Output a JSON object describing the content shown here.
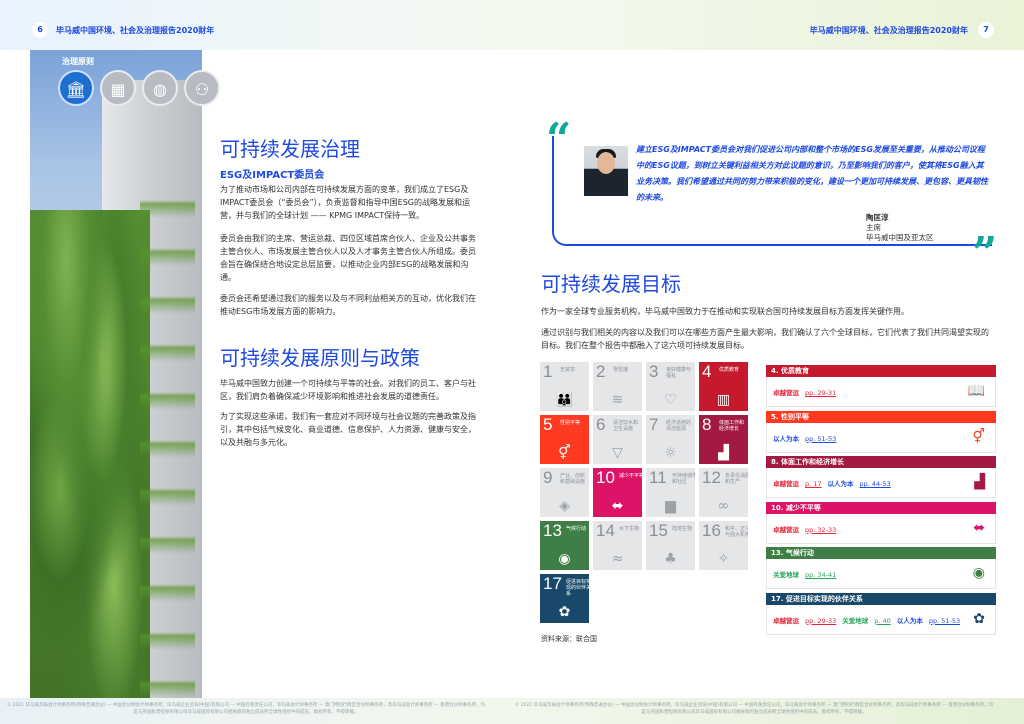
{
  "header": {
    "left_page": "6",
    "right_page": "7",
    "left_title": "毕马威中国环境、社会及治理报告2020财年",
    "right_title": "毕马威中国环境、社会及治理报告2020财年"
  },
  "governance": {
    "tag": "治理原则",
    "icons": [
      {
        "name": "pillars-icon",
        "glyph": "🏛"
      },
      {
        "name": "building-icon",
        "glyph": "▦"
      },
      {
        "name": "globe-icon",
        "glyph": "◍"
      },
      {
        "name": "people-icon",
        "glyph": "⚇"
      }
    ]
  },
  "left": {
    "title1": "可持续发展治理",
    "subtitle1": "ESG及IMPACT委员会",
    "p1": "为了推动市场和公司内部在可持续发展方面的变革，我们成立了ESG及IMPACT委员会（“委员会”），负责监督和指导中国ESG的战略发展和运营，并与我们的全球计划 —— KPMG IMPACT保持一致。",
    "p2": "委员会由我们的主席、营运总裁、四位区域首席合伙人、企业及公共事务主管合伙人、市场发展主管合伙人以及人才事务主管合伙人所组成。委员会旨在确保结合地设定总层监要，以推动企业内部ESG的战略发展和沟通。",
    "p3": "委员会还希望通过我们的服务以及与不同利益相关方的互动，优化我们在推动ESG市场发展方面的影响力。",
    "title2": "可持续发展原则与政策",
    "p4": "毕马威中国致力创建一个可持续与平等的社会。对我们的员工、客户与社区，我们肩负着确保减少环境影响和推进社会发展的道德责任。",
    "p5": "为了实现这些承诺，我们有一套应对不同环境与社会议题的完善政策及指引，其中包括气候变化、商业道德、信息保护、人力资源、健康与安全，以及共融与多元化。"
  },
  "quote": {
    "text": "建立ESG及IMPACT委员会对我们促进公司内部和整个市场的ESG发展至关重要，从推动公司议程中的ESG议题，到树立关键利益相关方对此议题的意识，乃至影响我们的客户，使其将ESG融入其业务决策。我们希望通过共同的努力带来积极的变化，建设一个更加可持续发展、更包容、更具韧性的未来。",
    "name": "陶匡淳",
    "role": "主席",
    "org": "毕马威中国及亚太区"
  },
  "right": {
    "title": "可持续发展目标",
    "p1": "作为一家全球专业服务机构，毕马威中国致力于在推动和实现联合国可持续发展目标方面发挥关键作用。",
    "p2": "通过识别与我们相关的内容以及我们可以在哪些方面产生最大影响，我们确认了六个全球目标，它们代表了我们共同渴望实现的目标。我们在整个报告中都融入了这六项可持续发展目标。",
    "source": "资料来源：联合国"
  },
  "sdg_tiles": [
    {
      "num": "1",
      "label": "无贫穷",
      "icon": "👪",
      "active": false,
      "color": "#e5243b"
    },
    {
      "num": "2",
      "label": "零饥饿",
      "icon": "≋",
      "active": false,
      "color": "#dda63a"
    },
    {
      "num": "3",
      "label": "良好健康与福祉",
      "icon": "♡",
      "active": false,
      "color": "#4c9f38"
    },
    {
      "num": "4",
      "label": "优质教育",
      "icon": "▥",
      "active": true,
      "color": "#c5192d"
    },
    {
      "num": "5",
      "label": "性别平等",
      "icon": "⚥",
      "active": true,
      "color": "#ff3a21"
    },
    {
      "num": "6",
      "label": "清洁饮水和卫生设施",
      "icon": "▽",
      "active": false,
      "color": "#26bde2"
    },
    {
      "num": "7",
      "label": "经济适用的清洁能源",
      "icon": "☼",
      "active": false,
      "color": "#fcc30b"
    },
    {
      "num": "8",
      "label": "体面工作和经济增长",
      "icon": "▟",
      "active": true,
      "color": "#a21942"
    },
    {
      "num": "9",
      "label": "产业、创新和基础设施",
      "icon": "◈",
      "active": false,
      "color": "#fd6925"
    },
    {
      "num": "10",
      "label": "减少不平等",
      "icon": "⬌",
      "active": true,
      "color": "#dd1367"
    },
    {
      "num": "11",
      "label": "可持续城市和社区",
      "icon": "▆",
      "active": false,
      "color": "#fd9d24"
    },
    {
      "num": "12",
      "label": "负责任消费和生产",
      "icon": "∞",
      "active": false,
      "color": "#bf8b2e"
    },
    {
      "num": "13",
      "label": "气候行动",
      "icon": "◉",
      "active": true,
      "color": "#3f7e44"
    },
    {
      "num": "14",
      "label": "水下生物",
      "icon": "≈",
      "active": false,
      "color": "#0a97d9"
    },
    {
      "num": "15",
      "label": "陆地生物",
      "icon": "♣",
      "active": false,
      "color": "#56c02b"
    },
    {
      "num": "16",
      "label": "和平、正义与强大机构",
      "icon": "✧",
      "active": false,
      "color": "#00689d"
    },
    {
      "num": "17",
      "label": "促进目标实现的伙伴关系",
      "icon": "✿",
      "active": true,
      "color": "#19486a"
    }
  ],
  "goals": [
    {
      "title": "4. 优质教育",
      "color": "#c5192d",
      "icon": "📖",
      "links": [
        {
          "cat": "卓越营运",
          "page": "pp. 29-31",
          "cat_color": "#e5243b"
        }
      ]
    },
    {
      "title": "5. 性别平等",
      "color": "#ff3a21",
      "icon": "⚥",
      "links": [
        {
          "cat": "以人为本",
          "page": "pp. 51-53",
          "cat_color": "#1e49e2"
        }
      ]
    },
    {
      "title": "8. 体面工作和经济增长",
      "color": "#a21942",
      "icon": "▟",
      "links": [
        {
          "cat": "卓越营运",
          "page": "p. 17",
          "cat_color": "#e5243b"
        },
        {
          "cat": "以人为本",
          "page": "pp. 44-53",
          "cat_color": "#1e49e2"
        }
      ]
    },
    {
      "title": "10. 减少不平等",
      "color": "#dd1367",
      "icon": "⬌",
      "links": [
        {
          "cat": "卓越营运",
          "page": "pp. 32-33",
          "cat_color": "#e5243b"
        }
      ]
    },
    {
      "title": "13. 气候行动",
      "color": "#3f7e44",
      "icon": "◉",
      "links": [
        {
          "cat": "关爱地球",
          "page": "pp. 34-41",
          "cat_color": "#26a65b"
        }
      ]
    },
    {
      "title": "17. 促进目标实现的伙伴关系",
      "color": "#19486a",
      "icon": "✿",
      "links": [
        {
          "cat": "卓越营运",
          "page": "pp. 29-33",
          "cat_color": "#e5243b"
        },
        {
          "cat": "关爱地球",
          "page": "p. 40",
          "cat_color": "#26a65b"
        },
        {
          "cat": "以人为本",
          "page": "pp. 51-53",
          "cat_color": "#1e49e2"
        }
      ]
    }
  ],
  "footer": {
    "left": "© 2021 毕马威华振会计师事务所(特殊普通合伙) — 中国合伙制会计师事务所，毕马威企业咨询(中国)有限公司 — 中国有限责任公司，毕马威会计师事务所 — 澳门特别行政区合伙制事务所，及毕马威会计师事务所 — 香港合伙制事务所，均是与英国私营担保有限公司毕马威国际有限公司相关联的独立成员所全球性组织中的成员。版权所有，不得转载。",
    "right": "© 2021 毕马威华振会计师事务所(特殊普通合伙) — 中国合伙制会计师事务所，毕马威企业咨询(中国)有限公司 — 中国有限责任公司，毕马威会计师事务所 — 澳门特别行政区合伙制事务所，及毕马威会计师事务所 — 香港合伙制事务所，均是与英国私营担保有限公司毕马威国际有限公司相关联的独立成员所全球性组织中的成员。版权所有，不得转载。"
  }
}
